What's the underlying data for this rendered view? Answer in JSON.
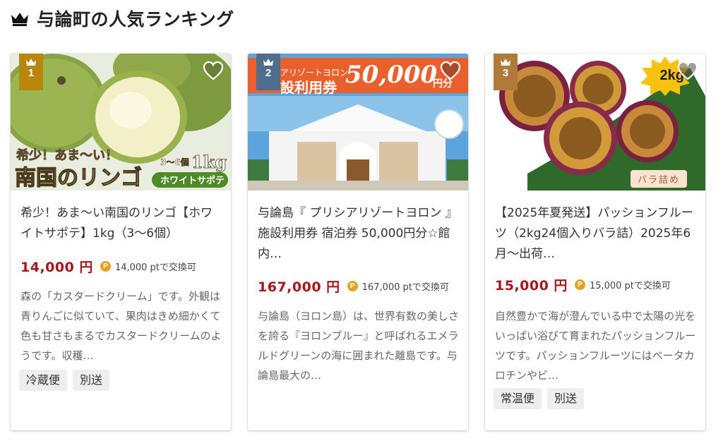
{
  "section": {
    "title": "与論町の人気ランキング",
    "icon": "crown-icon"
  },
  "cards": [
    {
      "rank": "1",
      "rank_color": "#b8860b",
      "image": {
        "banner_line1": "希少！あま〜い！",
        "banner_line2": "南国のリンゴ",
        "banner_count": "3〜6個",
        "banner_weight": "1kg",
        "banner_tag": "ホワイトサポテ"
      },
      "title": "希少！あま〜い南国のリンゴ【ホワイトサポテ】1kg（3〜6個）",
      "price": "14,000 円",
      "points": "14,000 ptで交換可",
      "description": "森の「カスタードクリーム」です。外観は青りんごに似ていて、果肉はきめ細かくて色も甘さもまるでカスタードクリームのようです。収穫…",
      "tags": [
        "冷蔵便",
        "別送"
      ]
    },
    {
      "rank": "2",
      "rank_color": "#4f6d8c",
      "image": {
        "banner_line1": "アリゾートヨロン",
        "banner_line2": "設利用券",
        "banner_amount": "50,000",
        "banner_unit": "円分"
      },
      "title": "与論島『 プリシアリゾートヨロン 』施設利用券 宿泊券 50,000円分☆館内…",
      "price": "167,000 円",
      "points": "167,000 ptで交換可",
      "description": "与論島（ヨロン島）は、世界有数の美しさを誇る『ヨロンブルー』と呼ばれるエメラルドグリーンの海に囲まれた離島です。与論島最大の…",
      "tags": []
    },
    {
      "rank": "3",
      "rank_color": "#b07a3a",
      "image": {
        "badge": "2kg",
        "label": "バラ詰め"
      },
      "title": "【2025年夏発送】パッションフルーツ（2kg24個入りバラ詰）2025年6月〜出荷…",
      "price": "15,000 円",
      "points": "15,000 ptで交換可",
      "description": "自然豊かで海が澄んでいる中で太陽の光をいっぱい浴びて育まれたパッションフルーツです。パッションフルーツにはベータカロチンやビ…",
      "tags": [
        "常温便",
        "別送"
      ]
    }
  ],
  "point_icon_label": "P",
  "colors": {
    "price": "#a5171c",
    "point": "#e3a21c",
    "tag_bg": "#eeeeee"
  }
}
